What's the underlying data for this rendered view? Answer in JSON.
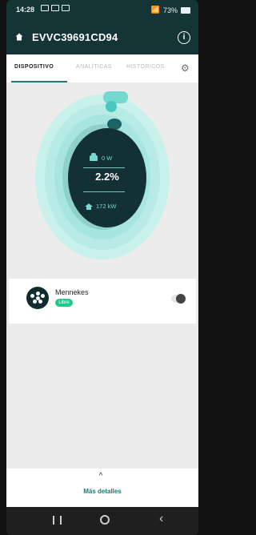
{
  "status_bar": {
    "time": "14:28",
    "battery": "73%"
  },
  "header": {
    "title": "EVVC39691CD94",
    "home_icon": "home-icon",
    "info_icon": "info-icon"
  },
  "tabs": [
    {
      "label": "DISPOSITIVO",
      "active": true
    },
    {
      "label": "ANALÍTICAS",
      "active": false
    },
    {
      "label": "HISTÓRICOS",
      "active": false
    }
  ],
  "meter": {
    "car_power": "0 W",
    "percentage": "2.2%",
    "house_power": "172 kW"
  },
  "connector": {
    "name": "Mennekes",
    "status": "Libre",
    "toggle_icon": "toggle-switch-icon"
  },
  "footer": {
    "more_label": "Más detalles"
  },
  "colors": {
    "header_bg": "#153436",
    "accent": "#1d7a78",
    "ring_outer": "#c9f1ec",
    "ring_mid": "#a7e6df",
    "ring_inner": "#8fd0ca",
    "center_bg": "#133034",
    "status_green": "#21c88c"
  }
}
